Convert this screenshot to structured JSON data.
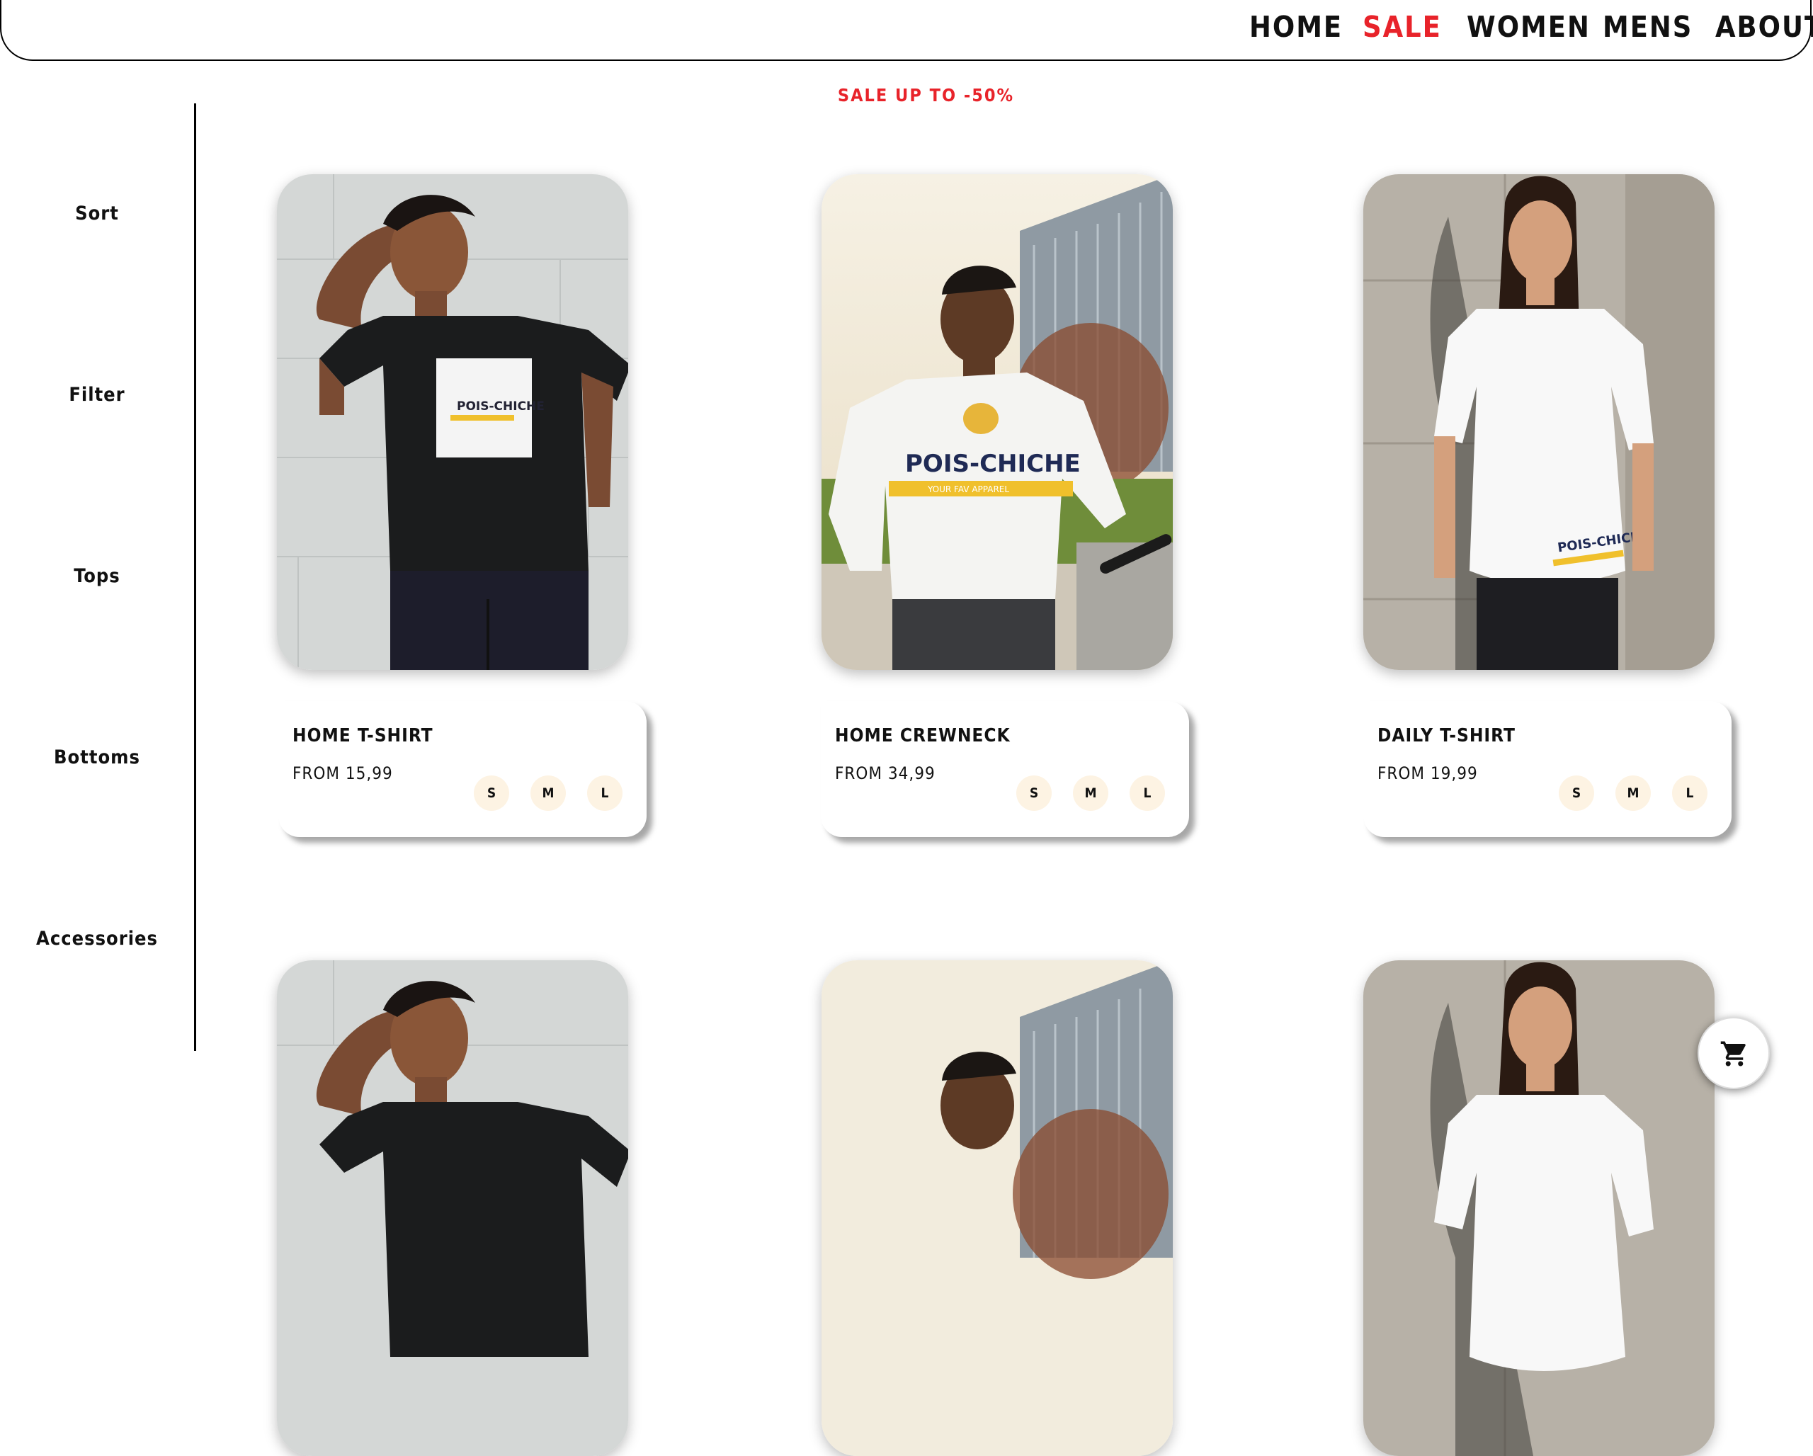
{
  "nav": {
    "items": [
      {
        "label": "HOME",
        "color": "#111111"
      },
      {
        "label": "SALE",
        "color": "#e8232a"
      },
      {
        "label": "WOMEN",
        "color": "#111111"
      },
      {
        "label": "MENS",
        "color": "#111111"
      },
      {
        "label": "ABOUT",
        "color": "#111111"
      }
    ]
  },
  "banner": {
    "text": "SALE UP TO -50%",
    "color": "#e8232a"
  },
  "sidebar": {
    "items": [
      {
        "label": "Sort"
      },
      {
        "label": "Filter"
      },
      {
        "label": "Tops"
      },
      {
        "label": "Bottoms"
      },
      {
        "label": "Accessories"
      }
    ]
  },
  "products": [
    {
      "name": "HOME T-SHIRT",
      "price": "FROM 15,99",
      "image": "man-black-tshirt-photo",
      "sizes": [
        "S",
        "M",
        "L"
      ]
    },
    {
      "name": "HOME CREWNECK",
      "price": "FROM 34,99",
      "image": "man-white-crewneck-photo",
      "sizes": [
        "S",
        "M",
        "L"
      ]
    },
    {
      "name": "DAILY T-SHIRT",
      "price": "FROM 19,99",
      "image": "woman-white-tshirt-photo",
      "sizes": [
        "S",
        "M",
        "L"
      ]
    }
  ],
  "image_prints": {
    "brand": "POIS-CHICHE",
    "tagline": "YOUR FAV APPAREL"
  },
  "cart": {
    "icon": "cart-icon"
  },
  "colors": {
    "accent_red": "#e8232a",
    "size_chip_bg": "#fdf3e3",
    "logo_yellow": "#f0c02c"
  }
}
